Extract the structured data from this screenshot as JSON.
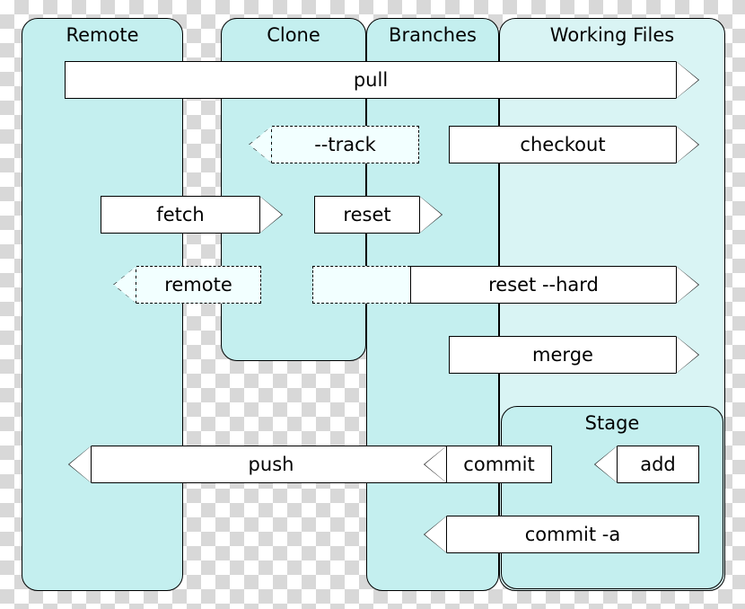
{
  "regions": {
    "remote": "Remote",
    "clone": "Clone",
    "branches": "Branches",
    "working_files": "Working Files",
    "stage": "Stage"
  },
  "commands": {
    "pull": "pull",
    "track": "--track",
    "checkout": "checkout",
    "fetch": "fetch",
    "reset": "reset",
    "remote": "remote",
    "reset_hard": "reset --hard",
    "merge": "merge",
    "push": "push",
    "commit": "commit",
    "add": "add",
    "commit_a": "commit -a"
  },
  "chart_data": {
    "type": "flow-diagram",
    "title": "Git transport / workflow commands",
    "areas": [
      "Remote",
      "Clone",
      "Branches",
      "Working Files",
      "Stage"
    ],
    "edges": [
      {
        "cmd": "pull",
        "from": "Remote",
        "to": "Working Files",
        "dir": "right",
        "style": "solid"
      },
      {
        "cmd": "--track",
        "from": "Branches",
        "to": "Clone",
        "dir": "left",
        "style": "dashed"
      },
      {
        "cmd": "checkout",
        "from": "Branches",
        "to": "Working Files",
        "dir": "right",
        "style": "solid"
      },
      {
        "cmd": "fetch",
        "from": "Remote",
        "to": "Clone",
        "dir": "right",
        "style": "solid"
      },
      {
        "cmd": "reset",
        "from": "Clone",
        "to": "Branches",
        "dir": "right",
        "style": "solid"
      },
      {
        "cmd": "remote",
        "from": "Clone",
        "to": "Remote",
        "dir": "left",
        "style": "dashed"
      },
      {
        "cmd": "reset --hard",
        "from": "Clone",
        "to": "Working Files",
        "dir": "right",
        "style": "solid-with-dashed-tail"
      },
      {
        "cmd": "merge",
        "from": "Branches",
        "to": "Working Files",
        "dir": "right",
        "style": "solid"
      },
      {
        "cmd": "push",
        "from": "Branches",
        "to": "Remote",
        "dir": "left",
        "style": "solid"
      },
      {
        "cmd": "commit",
        "from": "Stage",
        "to": "Branches",
        "dir": "left",
        "style": "solid"
      },
      {
        "cmd": "add",
        "from": "Working Files",
        "to": "Stage",
        "dir": "left",
        "style": "solid"
      },
      {
        "cmd": "commit -a",
        "from": "Working Files",
        "to": "Branches",
        "dir": "left",
        "style": "solid"
      }
    ],
    "nesting": {
      "Stage": "Working Files"
    }
  }
}
